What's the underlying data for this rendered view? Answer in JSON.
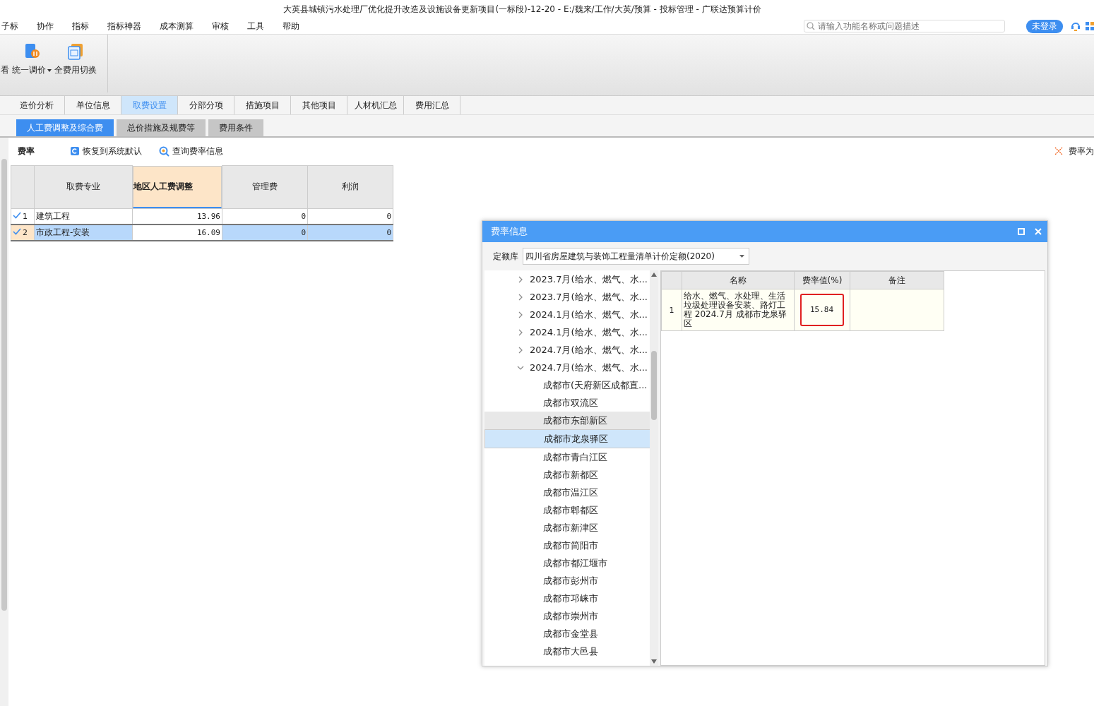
{
  "window": {
    "title": "大英县城镇污水处理厂优化提升改造及设施设备更新项目(一标段)-12-20 - E:/魏来/工作/大英/预算 - 投标管理 - 广联达预算计价"
  },
  "menu": [
    "子标",
    "协作",
    "指标",
    "指标神器",
    "成本测算",
    "审核",
    "工具",
    "帮助"
  ],
  "search": {
    "placeholder": "请输入功能名称或问题描述"
  },
  "login_badge": "未登录",
  "ribbon": [
    {
      "label": "看",
      "kind": "cut"
    },
    {
      "label": "统一调价",
      "kind": "dropdown"
    },
    {
      "label": "全费用切换",
      "kind": "plain"
    }
  ],
  "tabs": [
    {
      "label": "造价分析",
      "selected": false
    },
    {
      "label": "单位信息",
      "selected": false
    },
    {
      "label": "取费设置",
      "selected": true
    },
    {
      "label": "分部分项",
      "selected": false
    },
    {
      "label": "措施项目",
      "selected": false
    },
    {
      "label": "其他项目",
      "selected": false
    },
    {
      "label": "人材机汇总",
      "selected": false
    },
    {
      "label": "费用汇总",
      "selected": false
    }
  ],
  "subtabs": [
    {
      "label": "人工费调整及综合费",
      "selected": true
    },
    {
      "label": "总价措施及规费等",
      "selected": false
    },
    {
      "label": "费用条件",
      "selected": false
    }
  ],
  "toolbar": {
    "title": "费率",
    "actions": [
      {
        "label": "恢复到系统默认",
        "kind": "restore"
      },
      {
        "label": "查询费率信息",
        "kind": "query"
      }
    ],
    "right_label": "费率为"
  },
  "table": {
    "columns": [
      {
        "label": "取费专业",
        "selected": false
      },
      {
        "label": "地区人工费调整",
        "selected": true
      },
      {
        "label": "管理费",
        "selected": false
      },
      {
        "label": "利润",
        "selected": false
      }
    ],
    "rows": [
      {
        "index": "1",
        "checked": true,
        "selected": false,
        "cells": [
          "建筑工程",
          "13.96",
          "0",
          "0"
        ]
      },
      {
        "index": "2",
        "checked": true,
        "selected": true,
        "cells": [
          "市政工程-安装",
          "16.09",
          "0",
          "0"
        ]
      }
    ]
  },
  "dialog": {
    "title": "费率信息",
    "library_label": "定额库",
    "library_value": "四川省房屋建筑与装饰工程量清单计价定额(2020)",
    "tree": [
      {
        "label": "2023.7月(给水、燃气、水...",
        "expanded": false
      },
      {
        "label": "2023.7月(给水、燃气、水...",
        "expanded": false
      },
      {
        "label": "2024.1月(给水、燃气、水...",
        "expanded": false
      },
      {
        "label": "2024.1月(给水、燃气、水...",
        "expanded": false
      },
      {
        "label": "2024.7月(给水、燃气、水...",
        "expanded": false
      },
      {
        "label": "2024.7月(给水、燃气、水...",
        "expanded": true,
        "children": [
          {
            "label": "成都市(天府新区成都直...",
            "selected": false,
            "hovered": false
          },
          {
            "label": "成都市双流区",
            "selected": false,
            "hovered": false
          },
          {
            "label": "成都市东部新区",
            "selected": false,
            "hovered": true
          },
          {
            "label": "成都市龙泉驿区",
            "selected": true,
            "hovered": false
          },
          {
            "label": "成都市青白江区",
            "selected": false,
            "hovered": false
          },
          {
            "label": "成都市新都区",
            "selected": false,
            "hovered": false
          },
          {
            "label": "成都市温江区",
            "selected": false,
            "hovered": false
          },
          {
            "label": "成都市郫都区",
            "selected": false,
            "hovered": false
          },
          {
            "label": "成都市新津区",
            "selected": false,
            "hovered": false
          },
          {
            "label": "成都市简阳市",
            "selected": false,
            "hovered": false
          },
          {
            "label": "成都市都江堰市",
            "selected": false,
            "hovered": false
          },
          {
            "label": "成都市彭州市",
            "selected": false,
            "hovered": false
          },
          {
            "label": "成都市邛崃市",
            "selected": false,
            "hovered": false
          },
          {
            "label": "成都市崇州市",
            "selected": false,
            "hovered": false
          },
          {
            "label": "成都市金堂县",
            "selected": false,
            "hovered": false
          },
          {
            "label": "成都市大邑县",
            "selected": false,
            "hovered": false
          }
        ]
      }
    ],
    "grid": {
      "columns": [
        "名称",
        "费率值(%)",
        "备注"
      ],
      "rows": [
        {
          "index": "1",
          "name": "给水、燃气、水处理、生活垃圾处理设备安装、路灯工程 2024.7月 成都市龙泉驿区",
          "rate": "15.84",
          "rate_highlighted": true
        }
      ]
    }
  }
}
